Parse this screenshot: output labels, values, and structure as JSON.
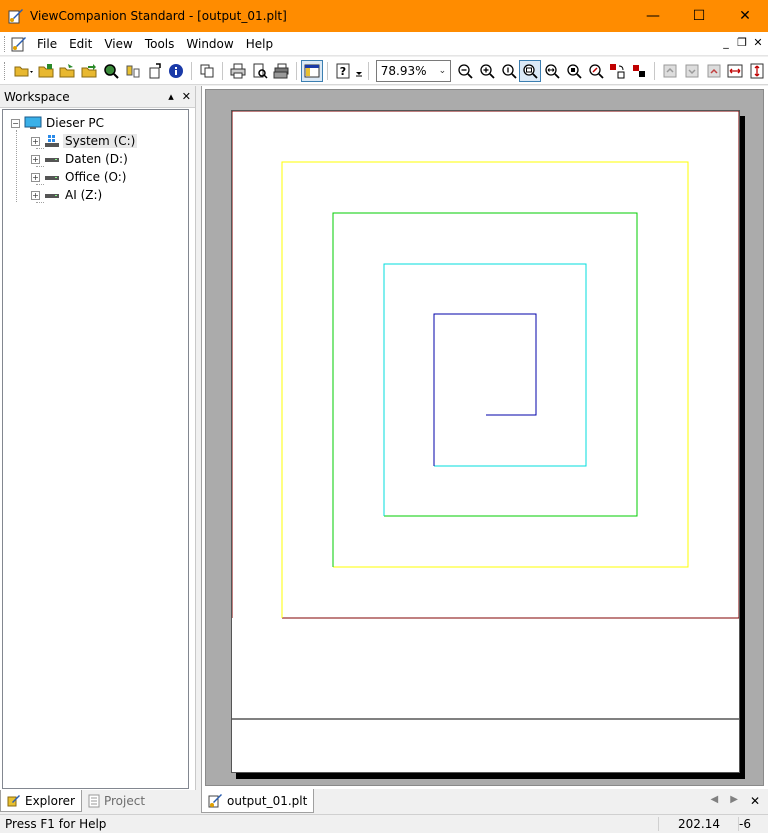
{
  "window": {
    "title": "ViewCompanion Standard - [output_01.plt]",
    "controls": {
      "minimize": "—",
      "maximize": "☐",
      "close": "✕"
    }
  },
  "menu": {
    "items": [
      {
        "label": "File"
      },
      {
        "label": "Edit"
      },
      {
        "label": "View"
      },
      {
        "label": "Tools"
      },
      {
        "label": "Window"
      },
      {
        "label": "Help"
      }
    ],
    "mdi": {
      "minimize": "_",
      "restore": "❐",
      "close": "✕"
    }
  },
  "toolbar": {
    "zoom_value": "78.93%"
  },
  "workspace": {
    "title": "Workspace",
    "tree": {
      "root": "Dieser PC",
      "drives": [
        {
          "label": "System (C:)"
        },
        {
          "label": "Daten (D:)"
        },
        {
          "label": "Office (O:)"
        },
        {
          "label": "AI (Z:)"
        }
      ]
    },
    "tabs": {
      "explorer": "Explorer",
      "project": "Project"
    }
  },
  "document": {
    "tab_label": "output_01.plt",
    "colors": {
      "border": "#800000",
      "yellow": "#ffff00",
      "green": "#00cc00",
      "cyan": "#00dddd",
      "blue": "#0000aa",
      "titlebar": "#ff8c00"
    }
  },
  "status": {
    "help": "Press F1 for Help",
    "x": "202.14",
    "y": "-6"
  }
}
